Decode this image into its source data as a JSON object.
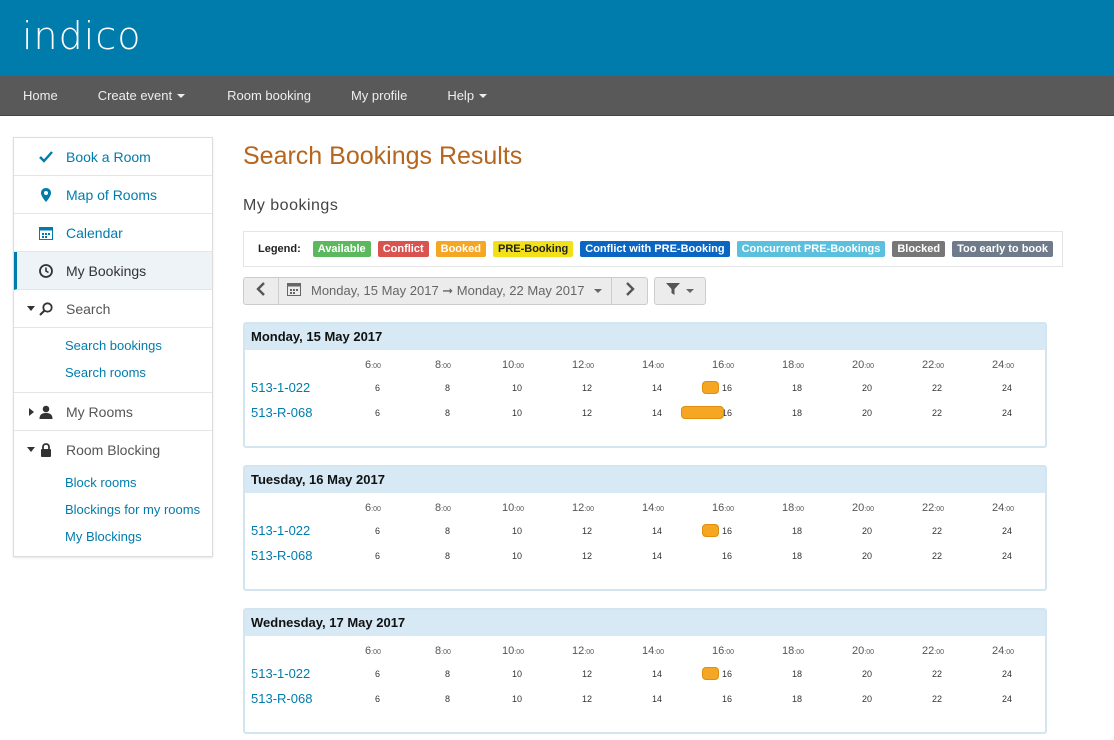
{
  "brand": {
    "logo_text": "indico"
  },
  "nav": [
    {
      "label": "Home",
      "caret": false
    },
    {
      "label": "Create event",
      "caret": true
    },
    {
      "label": "Room booking",
      "caret": false
    },
    {
      "label": "My profile",
      "caret": false
    },
    {
      "label": "Help",
      "caret": true
    }
  ],
  "sidebar": {
    "book_room": "Book a Room",
    "map_rooms": "Map of Rooms",
    "calendar": "Calendar",
    "my_bookings": "My Bookings",
    "search": "Search",
    "search_bookings": "Search bookings",
    "search_rooms": "Search rooms",
    "my_rooms": "My Rooms",
    "room_blocking": "Room Blocking",
    "block_rooms": "Block rooms",
    "blockings_for_my_rooms": "Blockings for my rooms",
    "my_blockings": "My Blockings"
  },
  "main": {
    "title": "Search Bookings Results",
    "section": "My bookings"
  },
  "legend": {
    "label": "Legend:",
    "items": [
      {
        "label": "Available",
        "color": "#5cb85c"
      },
      {
        "label": "Conflict",
        "color": "#d9534f"
      },
      {
        "label": "Booked",
        "color": "#f5a623"
      },
      {
        "label": "PRE-Booking",
        "color": "#f2e018",
        "text_color": "#222"
      },
      {
        "label": "Conflict with PRE-Booking",
        "color": "#0a66c2"
      },
      {
        "label": "Concurrent PRE-Bookings",
        "color": "#5bc0de"
      },
      {
        "label": "Blocked",
        "color": "#777777"
      },
      {
        "label": "Too early to book",
        "color": "#6f7b8a"
      }
    ]
  },
  "toolbar": {
    "date_range": "Monday, 15 May 2017 ➞ Monday, 22 May 2017"
  },
  "hours": [
    "6",
    "8",
    "10",
    "12",
    "14",
    "16",
    "18",
    "20",
    "22",
    "24"
  ],
  "hour_suffix": ":00",
  "days": [
    {
      "label": "Monday, 15 May 2017",
      "rooms": [
        {
          "name": "513-1-022",
          "bookings": [
            {
              "start": 15.1,
              "end": 15.6
            }
          ]
        },
        {
          "name": "513-R-068",
          "bookings": [
            {
              "start": 14.5,
              "end": 15.75
            }
          ]
        }
      ]
    },
    {
      "label": "Tuesday, 16 May 2017",
      "rooms": [
        {
          "name": "513-1-022",
          "bookings": [
            {
              "start": 15.1,
              "end": 15.6
            }
          ]
        },
        {
          "name": "513-R-068",
          "bookings": []
        }
      ]
    },
    {
      "label": "Wednesday, 17 May 2017",
      "rooms": [
        {
          "name": "513-1-022",
          "bookings": [
            {
              "start": 15.1,
              "end": 15.6
            }
          ]
        },
        {
          "name": "513-R-068",
          "bookings": []
        }
      ]
    }
  ]
}
